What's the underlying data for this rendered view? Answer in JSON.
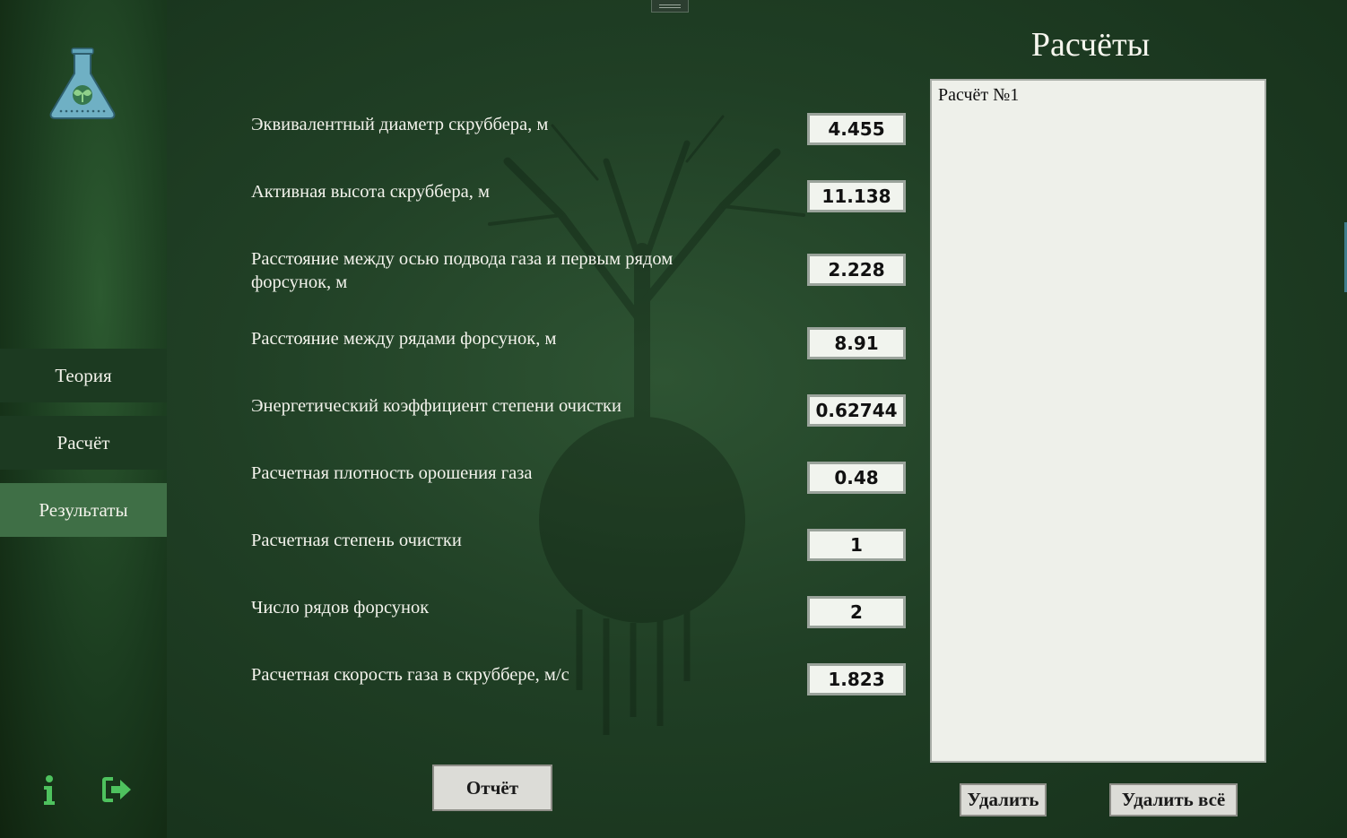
{
  "sidebar": {
    "nav": [
      {
        "label": "Теория"
      },
      {
        "label": "Расчёт"
      },
      {
        "label": "Результаты",
        "active": true
      }
    ],
    "icons": [
      "flask-logo-icon",
      "info-icon",
      "exit-icon"
    ]
  },
  "results": [
    {
      "label": "Эквивалентный диаметр скруббера, м",
      "value": "4.455"
    },
    {
      "label": "Активная высота скруббера, м",
      "value": "11.138"
    },
    {
      "label": "Расстояние между осью подвода газа и первым рядом форсунок, м",
      "value": "2.228"
    },
    {
      "label": "Расстояние между рядами форсунок, м",
      "value": "8.91"
    },
    {
      "label": "Энергетический коэффициент степени очистки",
      "value": "0.62744"
    },
    {
      "label": "Расчетная плотность орошения газа",
      "value": "0.48"
    },
    {
      "label": "Расчетная степень очистки",
      "value": "1"
    },
    {
      "label": "Число рядов форсунок",
      "value": "2"
    },
    {
      "label": "Расчетная скорость газа в скруббере, м/с",
      "value": "1.823"
    }
  ],
  "report_button": "Отчёт",
  "calculations": {
    "title": "Расчёты",
    "items": [
      "Расчёт №1"
    ],
    "delete_button": "Удалить",
    "delete_all_button": "Удалить всё"
  },
  "colors": {
    "background": "#1d3a22",
    "nav_active": "#3f6f46",
    "accent_green": "#4ec25e",
    "logo_blue": "#5fa3b8"
  }
}
